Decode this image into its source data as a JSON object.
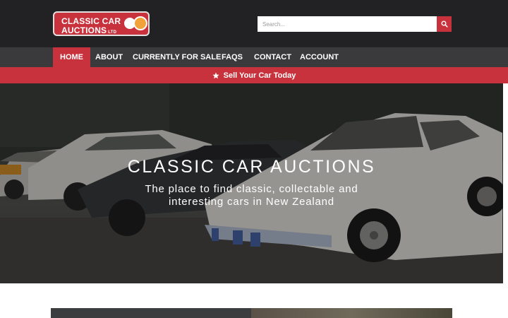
{
  "header": {
    "logo": {
      "line1": "CLASSIC CAR",
      "line2": "AUCTIONS",
      "suffix": "LTD"
    },
    "search": {
      "placeholder": "Search...",
      "icon": "search-icon"
    }
  },
  "nav": {
    "items": [
      {
        "label": "HOME",
        "active": true
      },
      {
        "label": "ABOUT",
        "active": false
      },
      {
        "label": "CURRENTLY FOR SALE",
        "active": false
      },
      {
        "label": "FAQS",
        "active": false
      },
      {
        "label": "CONTACT",
        "active": false
      },
      {
        "label": "ACCOUNT",
        "active": false
      }
    ]
  },
  "sell_bar": {
    "label": "Sell Your Car Today",
    "icon": "star-icon"
  },
  "hero": {
    "title": "CLASSIC CAR AUCTIONS",
    "subtitle_line1": "The place to find classic, collectable and",
    "subtitle_line2": "interesting cars in New Zealand"
  },
  "colors": {
    "brand_red": "#c8323c",
    "header_bg": "#222224",
    "nav_bg": "#3a3a3c",
    "logo_orange": "#f1a33a"
  }
}
